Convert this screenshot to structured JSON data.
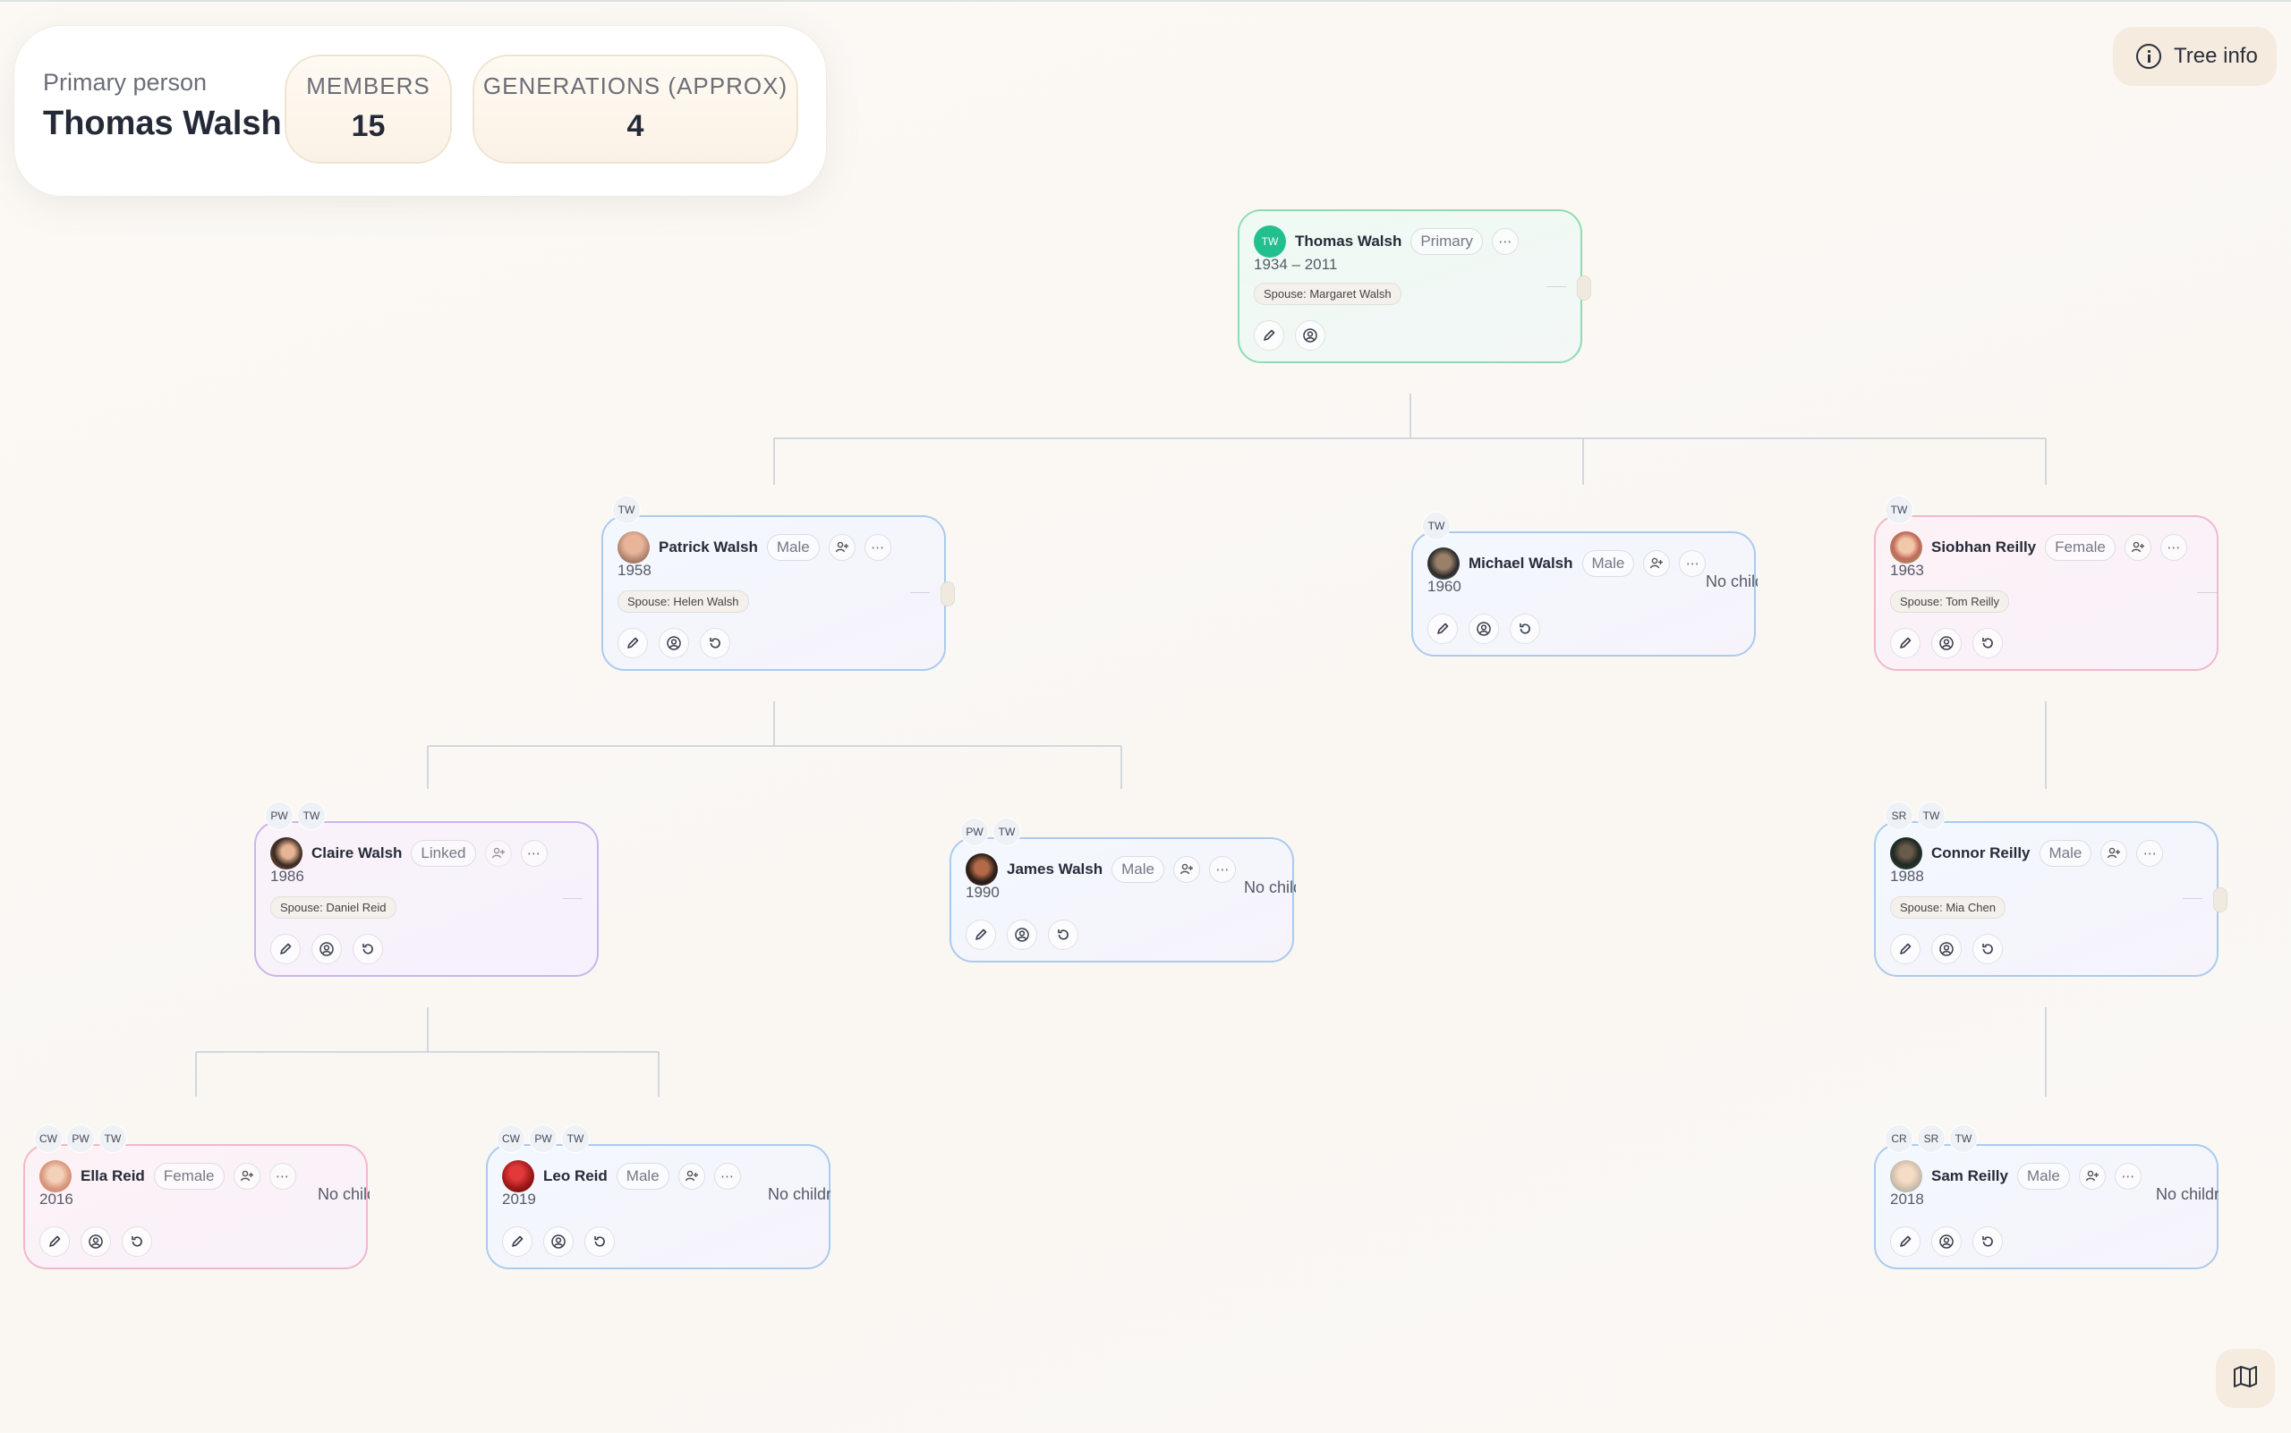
{
  "summary": {
    "primary_label": "Primary person",
    "primary_name": "Thomas Walsh",
    "members_label": "MEMBERS",
    "members_value": "15",
    "generations_label": "GENERATIONS (APPROX)",
    "generations_value": "4"
  },
  "toolbar": {
    "tree_info_label": "Tree info"
  },
  "icons": {
    "edit": "pencil-icon",
    "profile": "user-circle-icon",
    "reset": "rotate-icon",
    "add": "add-person-icon",
    "more": "more-horizontal-icon",
    "info": "info-icon",
    "map": "map-icon"
  },
  "colors": {
    "male_border": "#aacbee",
    "female_border": "#f0b8cd",
    "linked_border": "#cbb5ee",
    "primary_border": "#8fdcb4",
    "primary_avatar": "#22c08f"
  },
  "no_children_text": "No children",
  "people": {
    "thomas": {
      "name": "Thomas Walsh",
      "initials": "TW",
      "tag": "Primary",
      "years": "1934 – 2011",
      "spouse": "Spouse: Margaret Walsh"
    },
    "patrick": {
      "name": "Patrick Walsh",
      "tag": "Male",
      "years": "1958",
      "spouse": "Spouse: Helen Walsh",
      "chips": [
        "TW"
      ]
    },
    "michael": {
      "name": "Michael Walsh",
      "tag": "Male",
      "years": "1960",
      "chips": [
        "TW"
      ]
    },
    "siobhan": {
      "name": "Siobhan Reilly",
      "tag": "Female",
      "years": "1963",
      "spouse": "Spouse: Tom Reilly",
      "chips": [
        "TW"
      ]
    },
    "claire": {
      "name": "Claire Walsh",
      "tag": "Linked",
      "years": "1986",
      "spouse": "Spouse: Daniel Reid",
      "chips": [
        "PW",
        "TW"
      ]
    },
    "james": {
      "name": "James Walsh",
      "tag": "Male",
      "years": "1990",
      "chips": [
        "PW",
        "TW"
      ]
    },
    "connor": {
      "name": "Connor Reilly",
      "tag": "Male",
      "years": "1988",
      "spouse": "Spouse: Mia Chen",
      "chips": [
        "SR",
        "TW"
      ]
    },
    "ella": {
      "name": "Ella Reid",
      "tag": "Female",
      "years": "2016",
      "chips": [
        "CW",
        "PW",
        "TW"
      ]
    },
    "leo": {
      "name": "Leo Reid",
      "tag": "Male",
      "years": "2019",
      "chips": [
        "CW",
        "PW",
        "TW"
      ]
    },
    "sam": {
      "name": "Sam Reilly",
      "tag": "Male",
      "years": "2018",
      "chips": [
        "CR",
        "SR",
        "TW"
      ]
    }
  }
}
